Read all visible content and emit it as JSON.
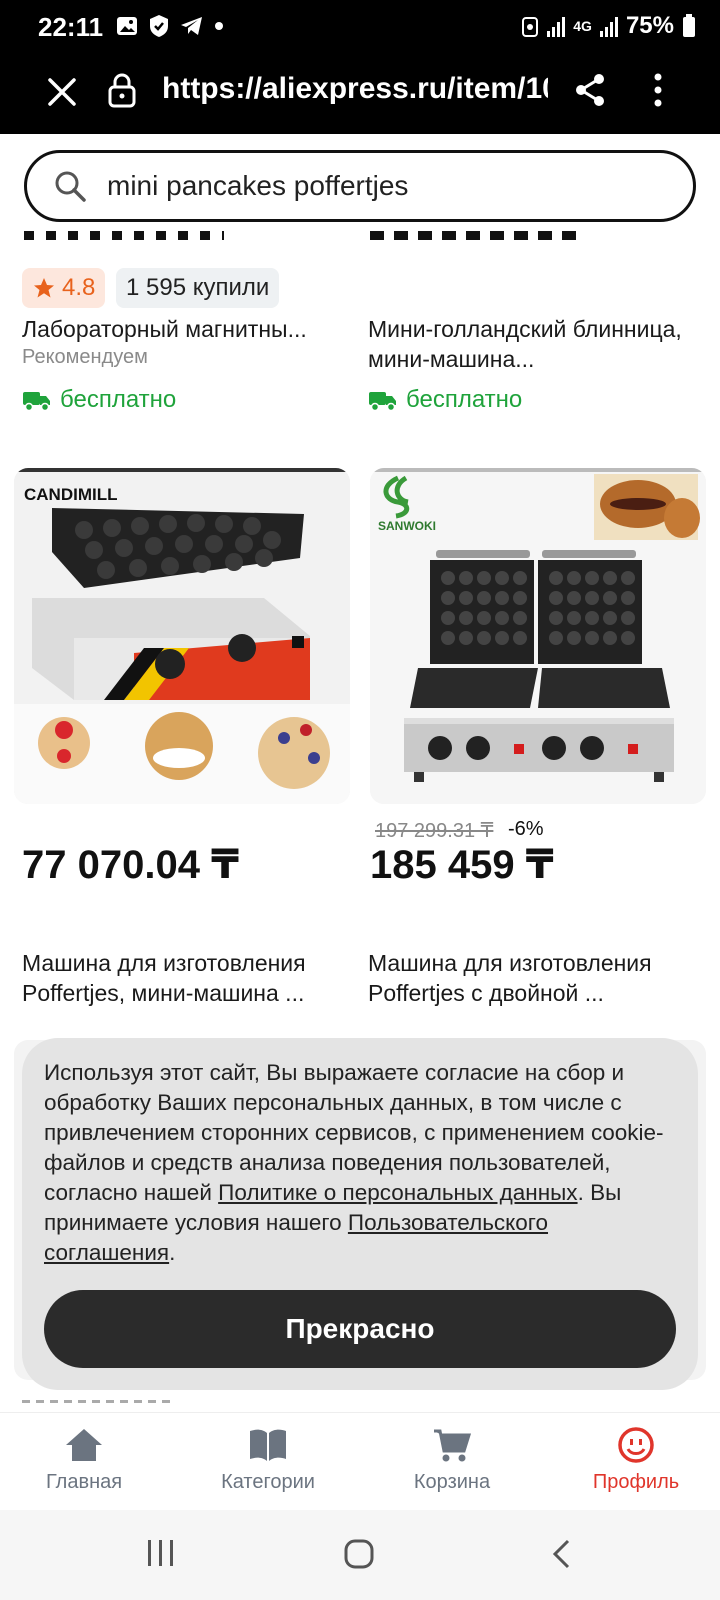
{
  "status_bar": {
    "time": "22:11",
    "battery": "75%",
    "network": "4G"
  },
  "url_bar": {
    "url": "https://aliexpress.ru/item/10"
  },
  "search": {
    "query": "mini pancakes poffertjes"
  },
  "top_cards": [
    {
      "rating": "4.8",
      "bought": "1 595 купили",
      "title": "Лабораторный магнитны...",
      "subtitle": "Рекомендуем",
      "shipping": "бесплатно"
    },
    {
      "title": "Мини-голландский блинница, мини-машина...",
      "shipping": "бесплатно"
    }
  ],
  "products": [
    {
      "brand": "CANDIMILL",
      "price": "77 070.04 ₸",
      "title": "Машина для изготовления Poffertjes, мини-машина ..."
    },
    {
      "brand": "SANWOKI",
      "old_price": "197 299.31 ₸",
      "discount": "-6%",
      "price": "185 459 ₸",
      "title": "Машина для изготовления Poffertjes с двойной ..."
    }
  ],
  "cookie_notice": {
    "text_1": "Используя этот сайт, Вы выражаете согласие на сбор и обработку Ваших персональных данных, в том числе с привлечением сторонних сервисов, с применением cookie-файлов и средств анализа поведения пользователей, согласно нашей ",
    "link_1": "Политике о персональных данных",
    "text_2": ". Вы принимаете условия нашего ",
    "link_2": "Пользовательского соглашения",
    "text_3": ".",
    "button": "Прекрасно"
  },
  "bottom_nav": [
    {
      "label": "Главная",
      "icon": "home-icon"
    },
    {
      "label": "Категории",
      "icon": "book-icon"
    },
    {
      "label": "Корзина",
      "icon": "cart-icon"
    },
    {
      "label": "Профиль",
      "icon": "profile-icon",
      "active": true
    }
  ],
  "colors": {
    "accent": "#e0352b",
    "free_shipping": "#1fa33b",
    "rating": "#e8621c"
  }
}
